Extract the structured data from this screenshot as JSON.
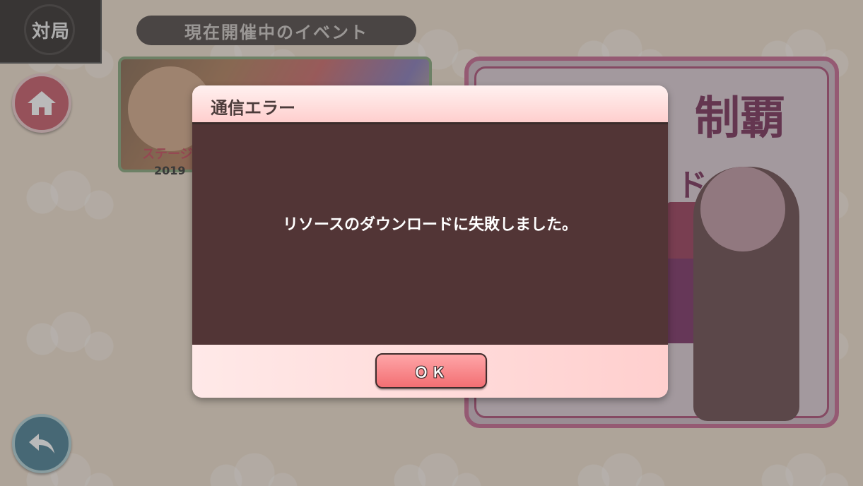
{
  "corner": {
    "label": "対局"
  },
  "header": {
    "event_title": "現在開催中のイベント"
  },
  "banners": {
    "left": {
      "stage_text": "ステージ",
      "date_text": "2019"
    },
    "right": {
      "title_text": "制覇",
      "sub_text": "ド"
    }
  },
  "dialog": {
    "title": "通信エラー",
    "message": "リソースのダウンロードに失敗しました。",
    "ok_label": "ＯＫ"
  },
  "icons": {
    "home": "home-icon",
    "back": "back-arrow-icon"
  },
  "colors": {
    "dialog_body": "#523536",
    "ok_button": "#f47a7e",
    "header_bar": "#3e3634"
  }
}
